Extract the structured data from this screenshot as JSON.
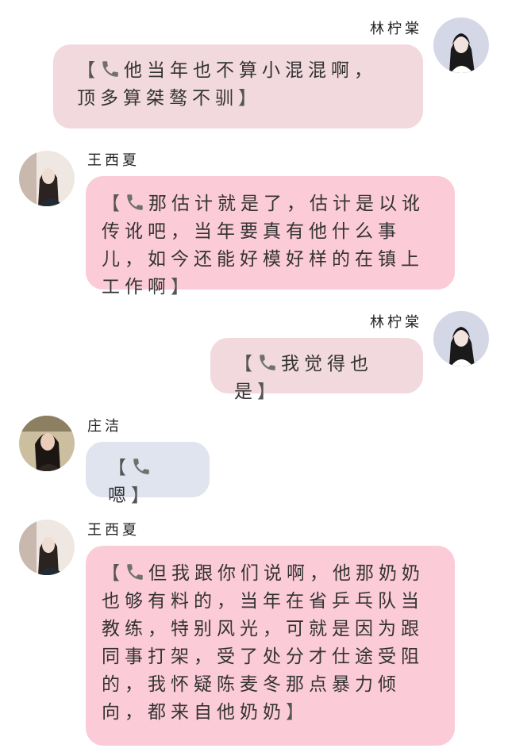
{
  "colors": {
    "bubble_self": "#f2d9de",
    "bubble_wang": "#fccbd8",
    "bubble_zhuang": "#dfe4ee"
  },
  "messages": [
    {
      "name": "林柠棠",
      "text": "他当年也不算小混混啊，顶多算桀骜不驯",
      "side": "right",
      "icon": "phone-icon"
    },
    {
      "name": "王西夏",
      "text": "那估计就是了，估计是以讹传讹吧，当年要真有他什么事儿，如今还能好模好样的在镇上工作啊",
      "side": "left",
      "icon": "phone-icon"
    },
    {
      "name": "林柠棠",
      "text": "我觉得也是",
      "side": "right",
      "icon": "phone-icon"
    },
    {
      "name": "庄洁",
      "text": "嗯",
      "side": "left",
      "icon": "phone-icon"
    },
    {
      "name": "王西夏",
      "text": "但我跟你们说啊，他那奶奶也够有料的，当年在省乒乓队当教练，特别风光，可就是因为跟同事打架，受了处分才仕途受阻的，我怀疑陈麦冬那点暴力倾向，都来自他奶奶",
      "side": "left",
      "icon": "phone-icon"
    }
  ],
  "brackets": {
    "open": "【",
    "close": "】"
  }
}
